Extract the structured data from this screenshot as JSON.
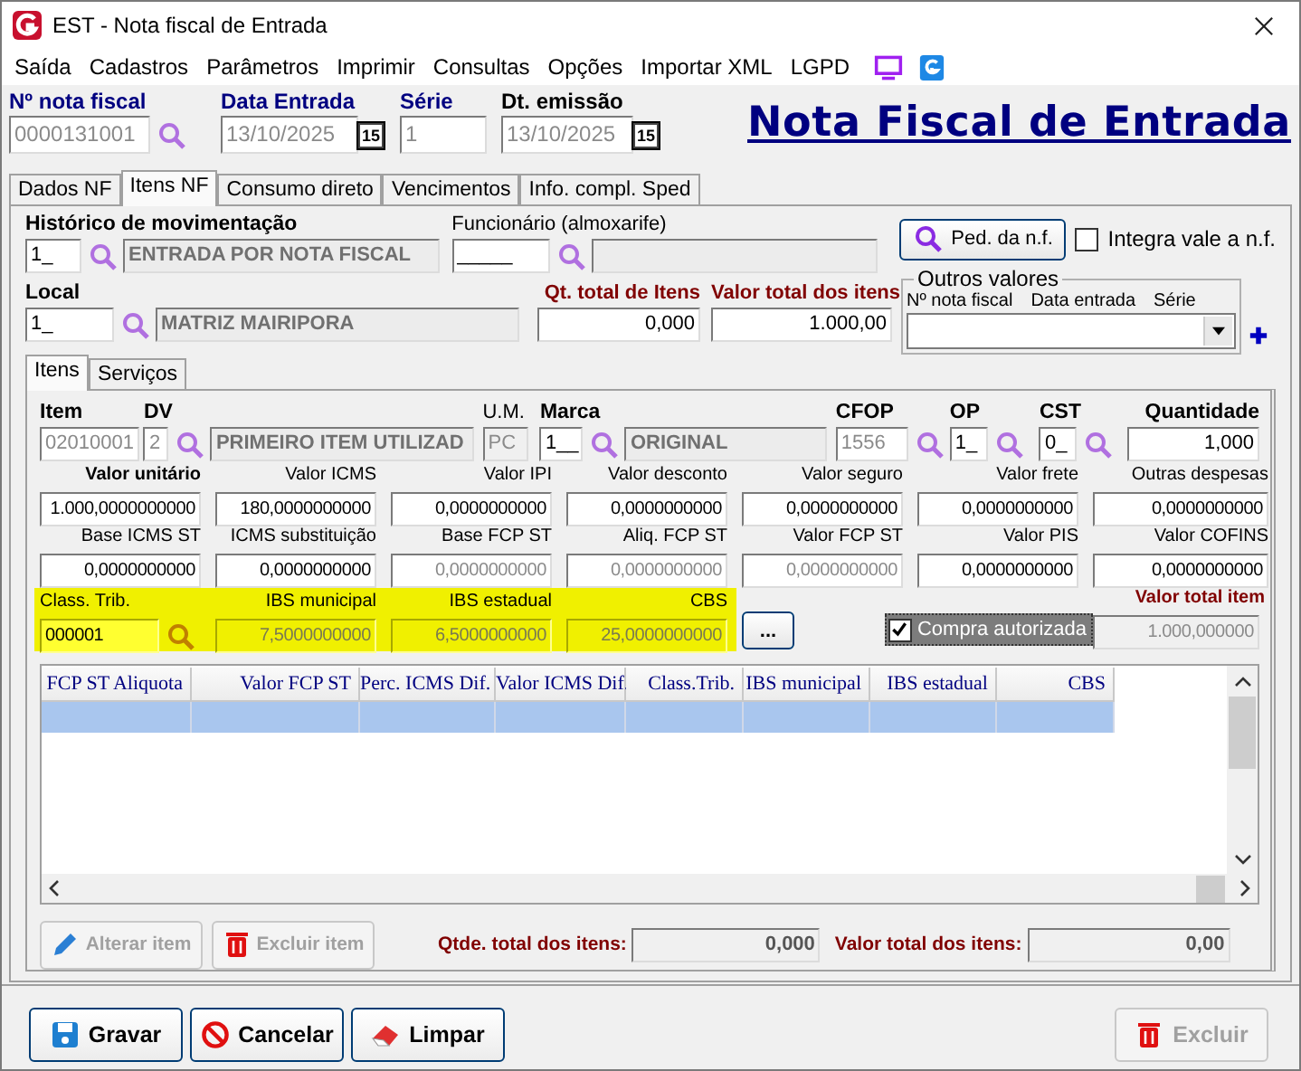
{
  "window": {
    "title": "EST - Nota fiscal de Entrada"
  },
  "menu": [
    "Saída",
    "Cadastros",
    "Parâmetros",
    "Imprimir",
    "Consultas",
    "Opções",
    "Importar XML",
    "LGPD"
  ],
  "header": {
    "fields": [
      {
        "label": "Nº nota fiscal",
        "value": "0000131001",
        "kind": "search",
        "disabled": true
      },
      {
        "label": "Data Entrada",
        "value": "13/10/2025",
        "kind": "date",
        "disabled": true,
        "calendar": "15"
      },
      {
        "label": "Série",
        "value": "1",
        "kind": "plain",
        "disabled": true
      },
      {
        "label": "Dt. emissão",
        "value": "13/10/2025",
        "kind": "date",
        "disabled": true,
        "calendar": "15"
      }
    ],
    "heading": "Nota Fiscal de Entrada"
  },
  "tabs": [
    {
      "label": "Dados NF",
      "selected": false
    },
    {
      "label": "Itens NF",
      "selected": true
    },
    {
      "label": "Consumo direto",
      "selected": false
    },
    {
      "label": "Vencimentos",
      "selected": false
    },
    {
      "label": "Info. compl. Sped",
      "selected": false
    }
  ],
  "movement": {
    "label": "Histórico de movimentação",
    "code": "1_",
    "description": "ENTRADA POR NOTA FISCAL"
  },
  "employee": {
    "label": "Funcionário (almoxarife)",
    "code": "_____"
  },
  "order_button": {
    "label": "Ped. da n.f."
  },
  "integrate": {
    "label": "Integra vale a n.f.",
    "checked": false
  },
  "location": {
    "label": "Local",
    "code": "1_",
    "description": "MATRIZ MAIRIPORA"
  },
  "totals": [
    {
      "label": "Qt. total de Itens",
      "value": "0,000"
    },
    {
      "label": "Valor total dos itens",
      "value": "1.000,00"
    }
  ],
  "other_values": {
    "title": "Outros valores",
    "columns": [
      "Nº nota fiscal",
      "Data entrada",
      "Série"
    ]
  },
  "inner_tabs": [
    {
      "label": "Itens",
      "selected": true
    },
    {
      "label": "Serviços",
      "selected": false
    }
  ],
  "item": {
    "code_label": "Item",
    "code": "02010001",
    "dv_label": "DV",
    "dv": "2",
    "description": "PRIMEIRO ITEM UTILIZAD",
    "unit_label": "U.M.",
    "unit": "PC",
    "brand_label": "Marca",
    "brand_code": "1__",
    "brand": "ORIGINAL",
    "cfop_label": "CFOP",
    "cfop": "1556",
    "op_label": "OP",
    "op": "1_",
    "cst_label": "CST",
    "cst": "0_",
    "qty_label": "Quantidade",
    "qty": "1,000"
  },
  "values": [
    [
      {
        "label": "Valor unitário",
        "value": "1.000,0000000000",
        "disabled": false
      },
      {
        "label": "Valor ICMS",
        "value": "180,0000000000",
        "disabled": false
      },
      {
        "label": "Valor IPI",
        "value": "0,0000000000",
        "disabled": false
      },
      {
        "label": "Valor desconto",
        "value": "0,0000000000",
        "disabled": false
      },
      {
        "label": "Valor seguro",
        "value": "0,0000000000",
        "disabled": false
      },
      {
        "label": "Valor frete",
        "value": "0,0000000000",
        "disabled": false
      },
      {
        "label": "Outras despesas",
        "value": "0,0000000000",
        "disabled": false
      }
    ],
    [
      {
        "label": "Base ICMS ST",
        "value": "0,0000000000",
        "disabled": false
      },
      {
        "label": "ICMS substituição",
        "value": "0,0000000000",
        "disabled": false
      },
      {
        "label": "Base FCP ST",
        "value": "0,0000000000",
        "disabled": true
      },
      {
        "label": "Aliq. FCP ST",
        "value": "0,0000000000",
        "disabled": true
      },
      {
        "label": "Valor FCP ST",
        "value": "0,0000000000",
        "disabled": true
      },
      {
        "label": "Valor PIS",
        "value": "0,0000000000",
        "disabled": false
      },
      {
        "label": "Valor COFINS",
        "value": "0,0000000000",
        "disabled": false
      }
    ]
  ],
  "tax": [
    {
      "label": "Class. Trib.",
      "value": "000001",
      "disabled": false
    },
    {
      "label": "IBS municipal",
      "value": "7,5000000000",
      "disabled": true
    },
    {
      "label": "IBS estadual",
      "value": "6,5000000000",
      "disabled": true
    },
    {
      "label": "CBS",
      "value": "25,0000000000",
      "disabled": true
    }
  ],
  "more_button": "...",
  "authorized": {
    "label": "Compra autorizada",
    "checked": true
  },
  "item_total": {
    "label": "Valor total item",
    "value": "1.000,000000"
  },
  "table": {
    "columns": [
      "FCP ST Aliquota",
      "Valor FCP ST",
      "Perc. ICMS Dif.",
      "Valor ICMS Dif.",
      "Class.Trib.",
      "IBS municipal",
      "IBS estadual",
      "CBS"
    ],
    "rows": [
      {
        "selected": true
      }
    ]
  },
  "item_buttons": [
    {
      "label": "Alterar item",
      "kind": "edit",
      "disabled": true
    },
    {
      "label": "Excluir item",
      "kind": "delete",
      "disabled": true
    }
  ],
  "summary": [
    {
      "label": "Qtde. total dos itens:",
      "value": "0,000"
    },
    {
      "label": "Valor total dos itens:",
      "value": "0,00"
    }
  ],
  "footer_buttons": [
    {
      "label": "Gravar",
      "kind": "save",
      "disabled": false
    },
    {
      "label": "Cancelar",
      "kind": "cancel",
      "disabled": false
    },
    {
      "label": "Limpar",
      "kind": "clear",
      "disabled": false
    },
    {
      "label": "Excluir",
      "kind": "delete",
      "disabled": true
    }
  ]
}
